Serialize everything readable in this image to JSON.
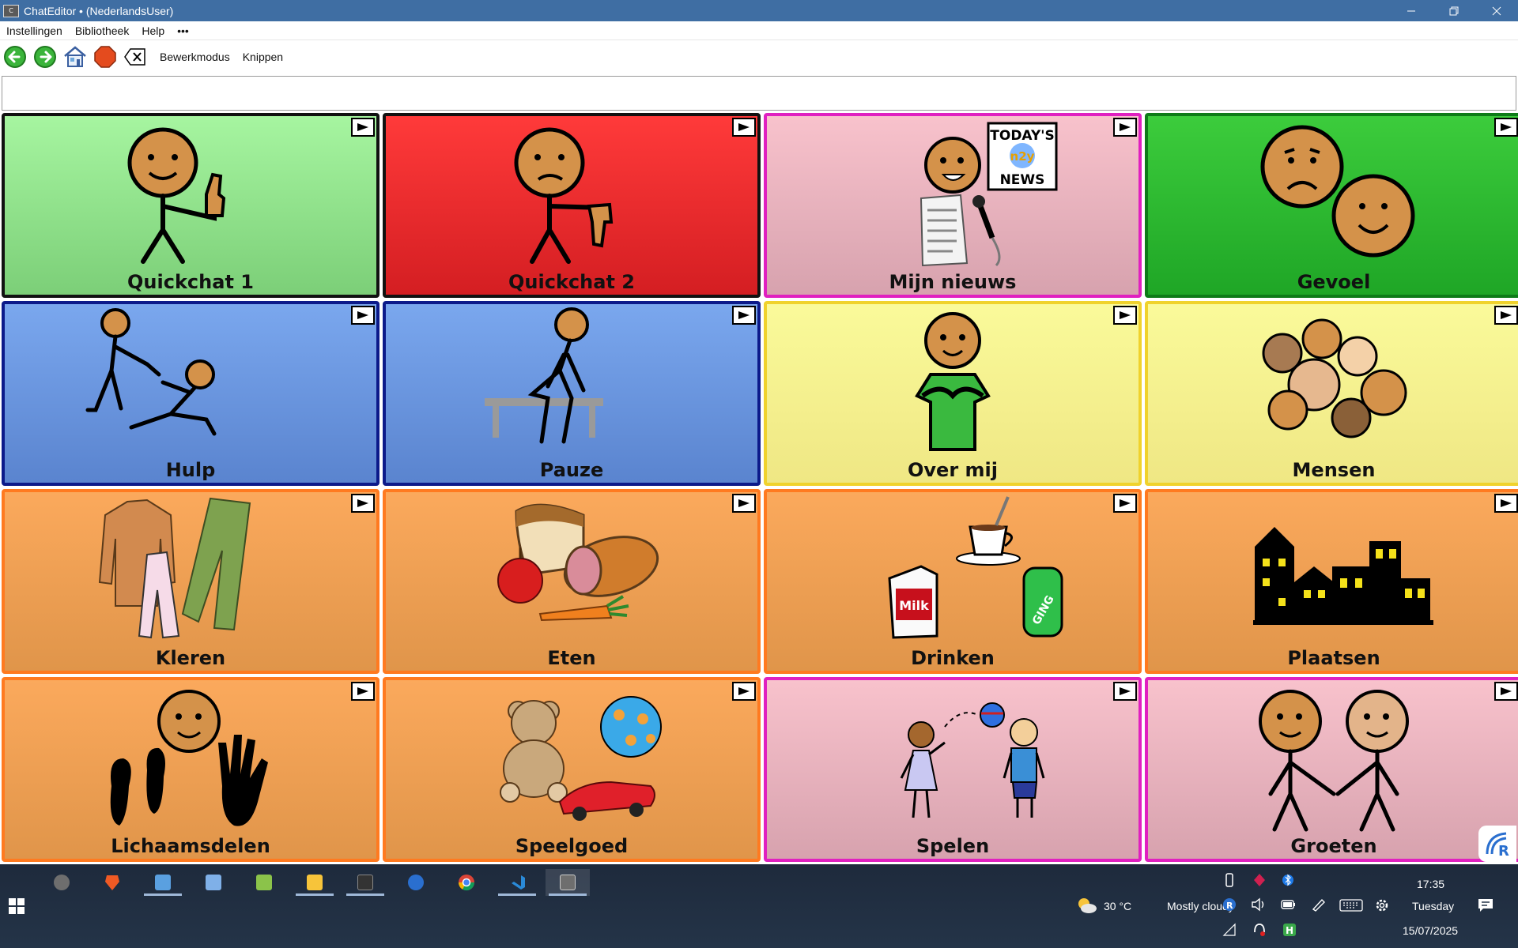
{
  "window": {
    "title": "ChatEditor • (NederlandsUser)",
    "app_icon_text": "C"
  },
  "menu": {
    "items": [
      "Instellingen",
      "Bibliotheek",
      "Help",
      "•••"
    ]
  },
  "toolbar": {
    "edit_mode_label": "Bewerkmodus",
    "cut_label": "Knippen"
  },
  "message_bar": {
    "value": ""
  },
  "grid": {
    "cells": [
      {
        "label": "Quickchat 1",
        "color": "green"
      },
      {
        "label": "Quickchat 2",
        "color": "red"
      },
      {
        "label": "Mijn nieuws",
        "color": "pink"
      },
      {
        "label": "Gevoel",
        "color": "dark-green"
      },
      {
        "label": "Hulp",
        "color": "blue"
      },
      {
        "label": "Pauze",
        "color": "blue"
      },
      {
        "label": "Over mij",
        "color": "yellow"
      },
      {
        "label": "Mensen",
        "color": "yellow"
      },
      {
        "label": "Kleren",
        "color": "orange"
      },
      {
        "label": "Eten",
        "color": "orange"
      },
      {
        "label": "Drinken",
        "color": "orange"
      },
      {
        "label": "Plaatsen",
        "color": "orange"
      },
      {
        "label": "Lichaamsdelen",
        "color": "orange"
      },
      {
        "label": "Speelgoed",
        "color": "orange"
      },
      {
        "label": "Spelen",
        "color": "pink"
      },
      {
        "label": "Groeten",
        "color": "pink"
      }
    ],
    "news_sign": [
      "TODAY'S",
      "n2y",
      "NEWS"
    ],
    "milk_label": "Milk",
    "can_label": "GING"
  },
  "taskbar": {
    "weather_temp": "30 °C",
    "weather_text": "Mostly cloudy",
    "time": "17:35",
    "day": "Tuesday",
    "date": "15/07/2025"
  },
  "colors": {
    "titlebar": "#3f6ea3",
    "green": "#8fe38a",
    "red": "#ee2a2e",
    "pink": "#f3bcc6",
    "dark_green": "#2eb833",
    "blue": "#6b96e0",
    "yellow": "#f7f290",
    "orange": "#f3a157",
    "skin": "#d4924a"
  }
}
